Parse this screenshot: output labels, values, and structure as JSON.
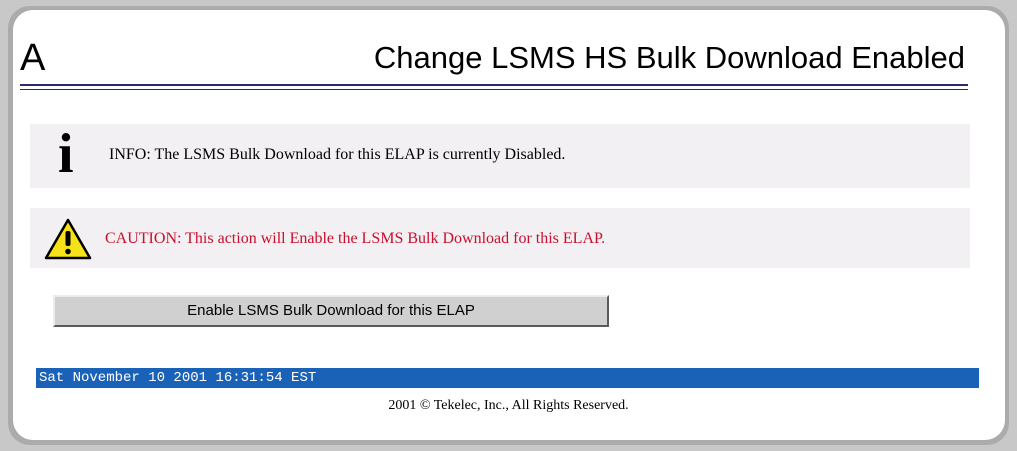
{
  "header": {
    "letter": "A",
    "title": "Change LSMS HS Bulk Download Enabled"
  },
  "info": {
    "icon": "info-icon",
    "message": "INFO: The LSMS Bulk Download for this ELAP is currently Disabled."
  },
  "caution": {
    "icon": "warning-triangle-icon",
    "message": "CAUTION: This action will Enable the LSMS Bulk Download for this ELAP.",
    "color": "#c8102e"
  },
  "action": {
    "button_label": "Enable LSMS Bulk Download for this ELAP"
  },
  "status": {
    "datetime": "Sat November 10 2001 16:31:54 EST",
    "bar_color": "#1a62b8"
  },
  "footer": {
    "copyright": "2001 © Tekelec, Inc., All Rights Reserved."
  }
}
